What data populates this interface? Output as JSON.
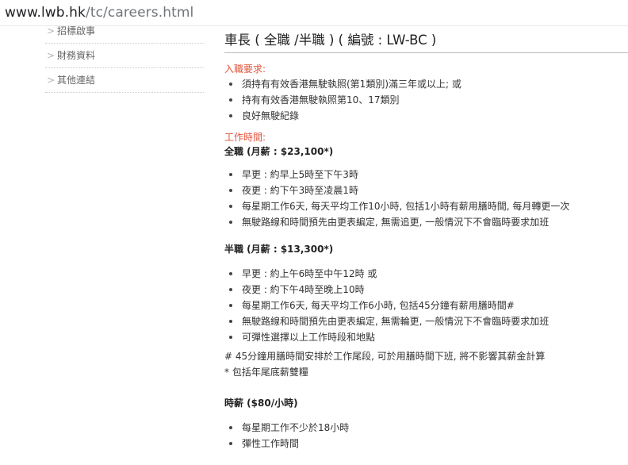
{
  "browser": {
    "url_host": "www.lwb.hk",
    "url_path": "/tc/careers.html"
  },
  "sidebar": {
    "items": [
      {
        "label": "招標啟事",
        "icon": "chevron-right-icon"
      },
      {
        "label": "財務資料",
        "icon": "chevron-right-icon"
      },
      {
        "label": "其他連結",
        "icon": "chevron-right-icon"
      }
    ]
  },
  "job": {
    "title": "車長 ( 全職 /半職 ) ( 編號 : LW-BC )",
    "requirements": {
      "heading": "入職要求:",
      "items": [
        "須持有有效香港無駛執照(第1類別)滿三年或以上; 或",
        "持有有效香港無駛執照第10、17類別",
        "良好無駛紀錄"
      ]
    },
    "hours": {
      "heading": "工作時間:",
      "fulltime": {
        "label": "全職 (月薪 : $23,100*)",
        "items": [
          "早更 : 約早上5時至下午3時",
          "夜更 : 約下午3時至凌晨1時",
          "每星期工作6天, 每天平均工作10小時, 包括1小時有薪用膳時間, 每月轉更一次",
          "無駛路線和時間預先由更表編定, 無需追更, 一般情況下不會臨時要求加班"
        ]
      },
      "parttime": {
        "label": "半職 (月薪 : $13,300*)",
        "items": [
          "早更 : 約上午6時至中午12時 或",
          "夜更 : 約下午4時至晚上10時",
          "每星期工作6天, 每天平均工作6小時, 包括45分鐘有薪用膳時間#",
          "無駛路線和時間預先由更表編定, 無需輪更, 一般情況下不會臨時要求加班",
          "可彈性選擇以上工作時段和地點"
        ]
      },
      "note_meal": "# 45分鐘用膳時間安排於工作尾段, 可於用膳時間下班, 將不影響其薪金計算",
      "note_bonus": "* 包括年尾底薪雙糧"
    },
    "hourly": {
      "label": "時薪 ($80/小時)",
      "items": [
        "每星期工作不少於18小時",
        "彈性工作時間"
      ]
    }
  },
  "colors": {
    "accent_red": "#e0533b",
    "text": "#333333",
    "sidebar_text": "#666666"
  }
}
